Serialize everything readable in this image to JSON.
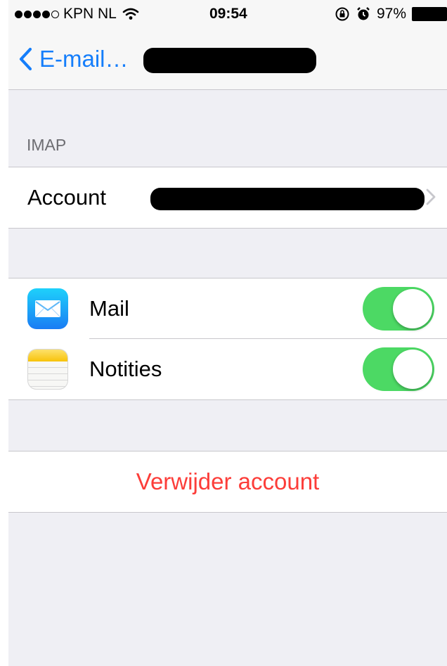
{
  "status_bar": {
    "signal_dots": 5,
    "signal_dots_filled": 4,
    "carrier": "KPN NL",
    "wifi_icon": "wifi-icon",
    "time": "09:54",
    "lock_icon": "rotation-lock-icon",
    "alarm_icon": "alarm-icon",
    "battery": "97%",
    "battery_level": 0.97
  },
  "navbar": {
    "back_label": "E-mail…",
    "back_icon": "chevron-left-icon",
    "title_redacted": true
  },
  "imap_section": {
    "header": "IMAP",
    "account_label": "Account",
    "account_value_redacted": true
  },
  "apps": [
    {
      "label": "Mail",
      "icon": "mail-icon",
      "enabled": true
    },
    {
      "label": "Notities",
      "icon": "notes-icon",
      "enabled": true
    }
  ],
  "delete_label": "Verwijder account",
  "colors": {
    "tint": "#157efb",
    "toggle_on": "#4cd964",
    "destructive": "#fc3d39",
    "background": "#efeff4"
  }
}
